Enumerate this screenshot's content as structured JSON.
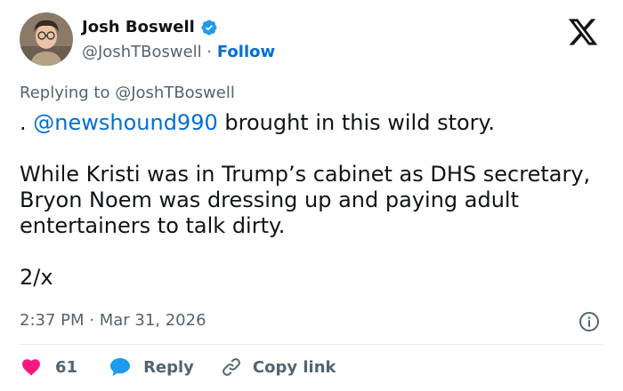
{
  "author": {
    "name": "Josh Boswell",
    "handle": "@JoshTBoswell",
    "separator": "·",
    "follow_label": "Follow"
  },
  "replying_to": {
    "prefix": "Replying to",
    "handle": "@JoshTBoswell"
  },
  "tweet": {
    "line1_prefix": ". ",
    "line1_mention": "@newshound990",
    "line1_rest": " brought in this wild story.",
    "paragraph2": "While Kristi was in Trump’s cabinet as DHS secretary,  Bryon Noem was dressing up and paying adult entertainers to talk dirty.",
    "paragraph3": "2/x"
  },
  "timestamp": "2:37 PM · Mar 31, 2026",
  "actions": {
    "like_count": "61",
    "reply_label": "Reply",
    "copy_link_label": "Copy link"
  },
  "icons": {
    "verified": "verified-badge-icon",
    "logo": "x-logo-icon",
    "info": "info-icon",
    "like": "heart-icon",
    "reply": "reply-bubble-icon",
    "link": "link-icon"
  },
  "colors": {
    "link_blue": "#006fd6",
    "verified_blue": "#1d9bf0",
    "like_pink": "#f91880",
    "muted": "#536471"
  }
}
